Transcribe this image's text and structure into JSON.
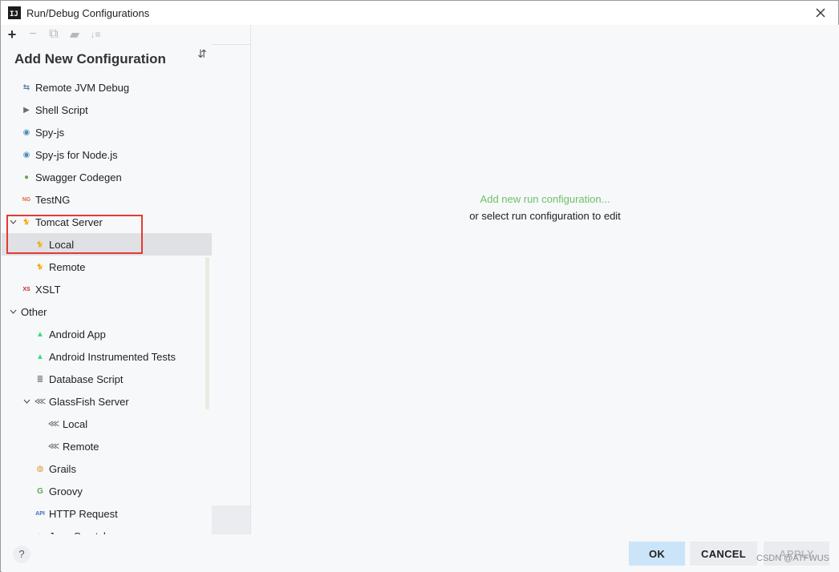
{
  "window": {
    "title": "Run/Debug Configurations",
    "app_icon_text": "IJ"
  },
  "toolbar": {
    "add": "+",
    "remove": "−",
    "copy": "⧉",
    "folder": "▰",
    "sort": "↓≡"
  },
  "left": {
    "heading": "Add New Configuration",
    "collapse_glyph": "⇵"
  },
  "tree": [
    {
      "label": "Remote JVM Debug",
      "icon": "remote-debug-icon",
      "glyph": "⇆",
      "color": "#5a7da6",
      "indent": 24
    },
    {
      "label": "Shell Script",
      "icon": "shell-script-icon",
      "glyph": "▶",
      "color": "#6d6d6d",
      "indent": 24
    },
    {
      "label": "Spy-js",
      "icon": "spy-js-icon",
      "glyph": "◉",
      "color": "#4a8bb5",
      "indent": 24
    },
    {
      "label": "Spy-js for Node.js",
      "icon": "spy-js-node-icon",
      "glyph": "◉",
      "color": "#4a8bb5",
      "indent": 24
    },
    {
      "label": "Swagger Codegen",
      "icon": "swagger-icon",
      "glyph": "●",
      "color": "#6aa84f",
      "indent": 24
    },
    {
      "label": "TestNG",
      "icon": "testng-icon",
      "glyph": "NG",
      "color": "#e06d3b",
      "indent": 24
    },
    {
      "label": "Tomcat Server",
      "icon": "tomcat-icon",
      "glyph": "🐈",
      "color": "#d4a017",
      "indent": 24,
      "chevron": "v"
    },
    {
      "label": "Local",
      "icon": "tomcat-local-icon",
      "glyph": "🐈",
      "color": "#d4a017",
      "indent": 41,
      "selected": true
    },
    {
      "label": "Remote",
      "icon": "tomcat-remote-icon",
      "glyph": "🐈",
      "color": "#d4a017",
      "indent": 41
    },
    {
      "label": "XSLT",
      "icon": "xslt-icon",
      "glyph": "XS",
      "color": "#c62828",
      "indent": 24
    },
    {
      "label": "Other",
      "icon": "",
      "glyph": "",
      "color": "",
      "indent": 24,
      "chevron": "v"
    },
    {
      "label": "Android App",
      "icon": "android-icon",
      "glyph": "▲",
      "color": "#3ddc84",
      "indent": 41
    },
    {
      "label": "Android Instrumented Tests",
      "icon": "android-test-icon",
      "glyph": "▲",
      "color": "#3ddc84",
      "indent": 41
    },
    {
      "label": "Database Script",
      "icon": "database-icon",
      "glyph": "≣",
      "color": "#6d6d6d",
      "indent": 41
    },
    {
      "label": "GlassFish Server",
      "icon": "glassfish-icon",
      "glyph": "⋘",
      "color": "#777",
      "indent": 41,
      "chevron": "v"
    },
    {
      "label": "Local",
      "icon": "glassfish-local-icon",
      "glyph": "⋘",
      "color": "#777",
      "indent": 58
    },
    {
      "label": "Remote",
      "icon": "glassfish-remote-icon",
      "glyph": "⋘",
      "color": "#777",
      "indent": 58
    },
    {
      "label": "Grails",
      "icon": "grails-icon",
      "glyph": "◍",
      "color": "#e8913b",
      "indent": 41
    },
    {
      "label": "Groovy",
      "icon": "groovy-icon",
      "glyph": "G",
      "color": "#5fa55a",
      "indent": 41
    },
    {
      "label": "HTTP Request",
      "icon": "http-request-icon",
      "glyph": "API",
      "color": "#3d6fb5",
      "indent": 41
    },
    {
      "label": "Java Scratch",
      "icon": "java-scratch-icon",
      "glyph": "☕",
      "color": "#3d6fb5",
      "indent": 41
    }
  ],
  "main": {
    "link": "Add new run configuration...",
    "hint": "or select run configuration to edit"
  },
  "footer": {
    "help": "?",
    "ok": "OK",
    "cancel": "CANCEL",
    "apply": "APPLY"
  },
  "watermark": "CSDN @ATFWUS"
}
